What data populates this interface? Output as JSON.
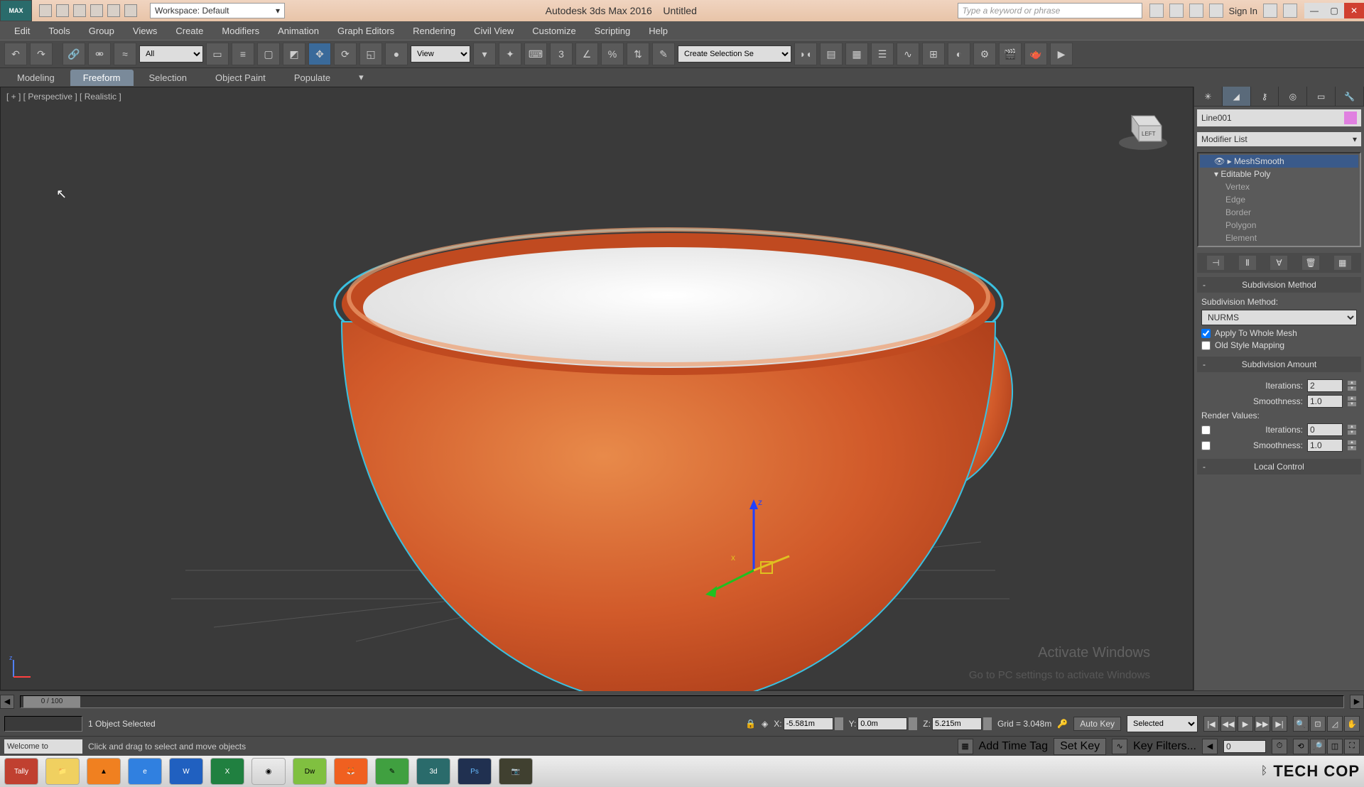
{
  "title": {
    "app": "Autodesk 3ds Max 2016",
    "doc": "Untitled",
    "logo": "MAX"
  },
  "workspace": {
    "label": "Workspace: Default"
  },
  "search": {
    "placeholder": "Type a keyword or phrase"
  },
  "signin": "Sign In",
  "menu": [
    "Edit",
    "Tools",
    "Group",
    "Views",
    "Create",
    "Modifiers",
    "Animation",
    "Graph Editors",
    "Rendering",
    "Civil View",
    "Customize",
    "Scripting",
    "Help"
  ],
  "toolbar": {
    "filter": "All",
    "refsys": "View",
    "selset": "Create Selection Se"
  },
  "ribbon": {
    "tabs": [
      "Modeling",
      "Freeform",
      "Selection",
      "Object Paint",
      "Populate"
    ],
    "active": 1
  },
  "viewport": {
    "label": "[ + ] [ Perspective ] [ Realistic ]"
  },
  "watermark": {
    "line1": "Activate Windows",
    "line2": "Go to PC settings to activate Windows"
  },
  "command_panel": {
    "object_name": "Line001",
    "modlist": "Modifier List",
    "stack": [
      "MeshSmooth",
      "Editable Poly",
      "Vertex",
      "Edge",
      "Border",
      "Polygon",
      "Element"
    ],
    "rollouts": {
      "subdiv_method": {
        "title": "Subdivision Method",
        "label": "Subdivision Method:",
        "value": "NURMS",
        "apply": "Apply To Whole Mesh",
        "old": "Old Style Mapping"
      },
      "subdiv_amount": {
        "title": "Subdivision Amount",
        "iterations_lbl": "Iterations:",
        "iterations": "2",
        "smooth_lbl": "Smoothness:",
        "smooth": "1.0",
        "render_lbl": "Render Values:",
        "r_iter": "0",
        "r_smooth": "1.0"
      },
      "local": {
        "title": "Local Control"
      }
    }
  },
  "timeline": {
    "pos": "0 / 100"
  },
  "status": {
    "sel": "1 Object Selected",
    "x_lbl": "X:",
    "x": "-5.581m",
    "y_lbl": "Y:",
    "y": "0.0m",
    "z_lbl": "Z:",
    "z": "5.215m",
    "grid": "Grid = 3.048m",
    "autokey": "Auto Key",
    "selected": "Selected",
    "setkey": "Set Key",
    "keyfilters": "Key Filters...",
    "frame": "0"
  },
  "status2": {
    "welcome": "Welcome to",
    "hint": "Click and drag to select and move objects",
    "timetag": "Add Time Tag"
  },
  "taskbar": {
    "apps": [
      "Tally",
      "Files",
      "VLC",
      "IE",
      "Word",
      "Excel",
      "Chrome",
      "Dw",
      "FF",
      "Corel",
      "3ds",
      "Ps",
      "Cam"
    ],
    "brand": "TECH COP"
  }
}
